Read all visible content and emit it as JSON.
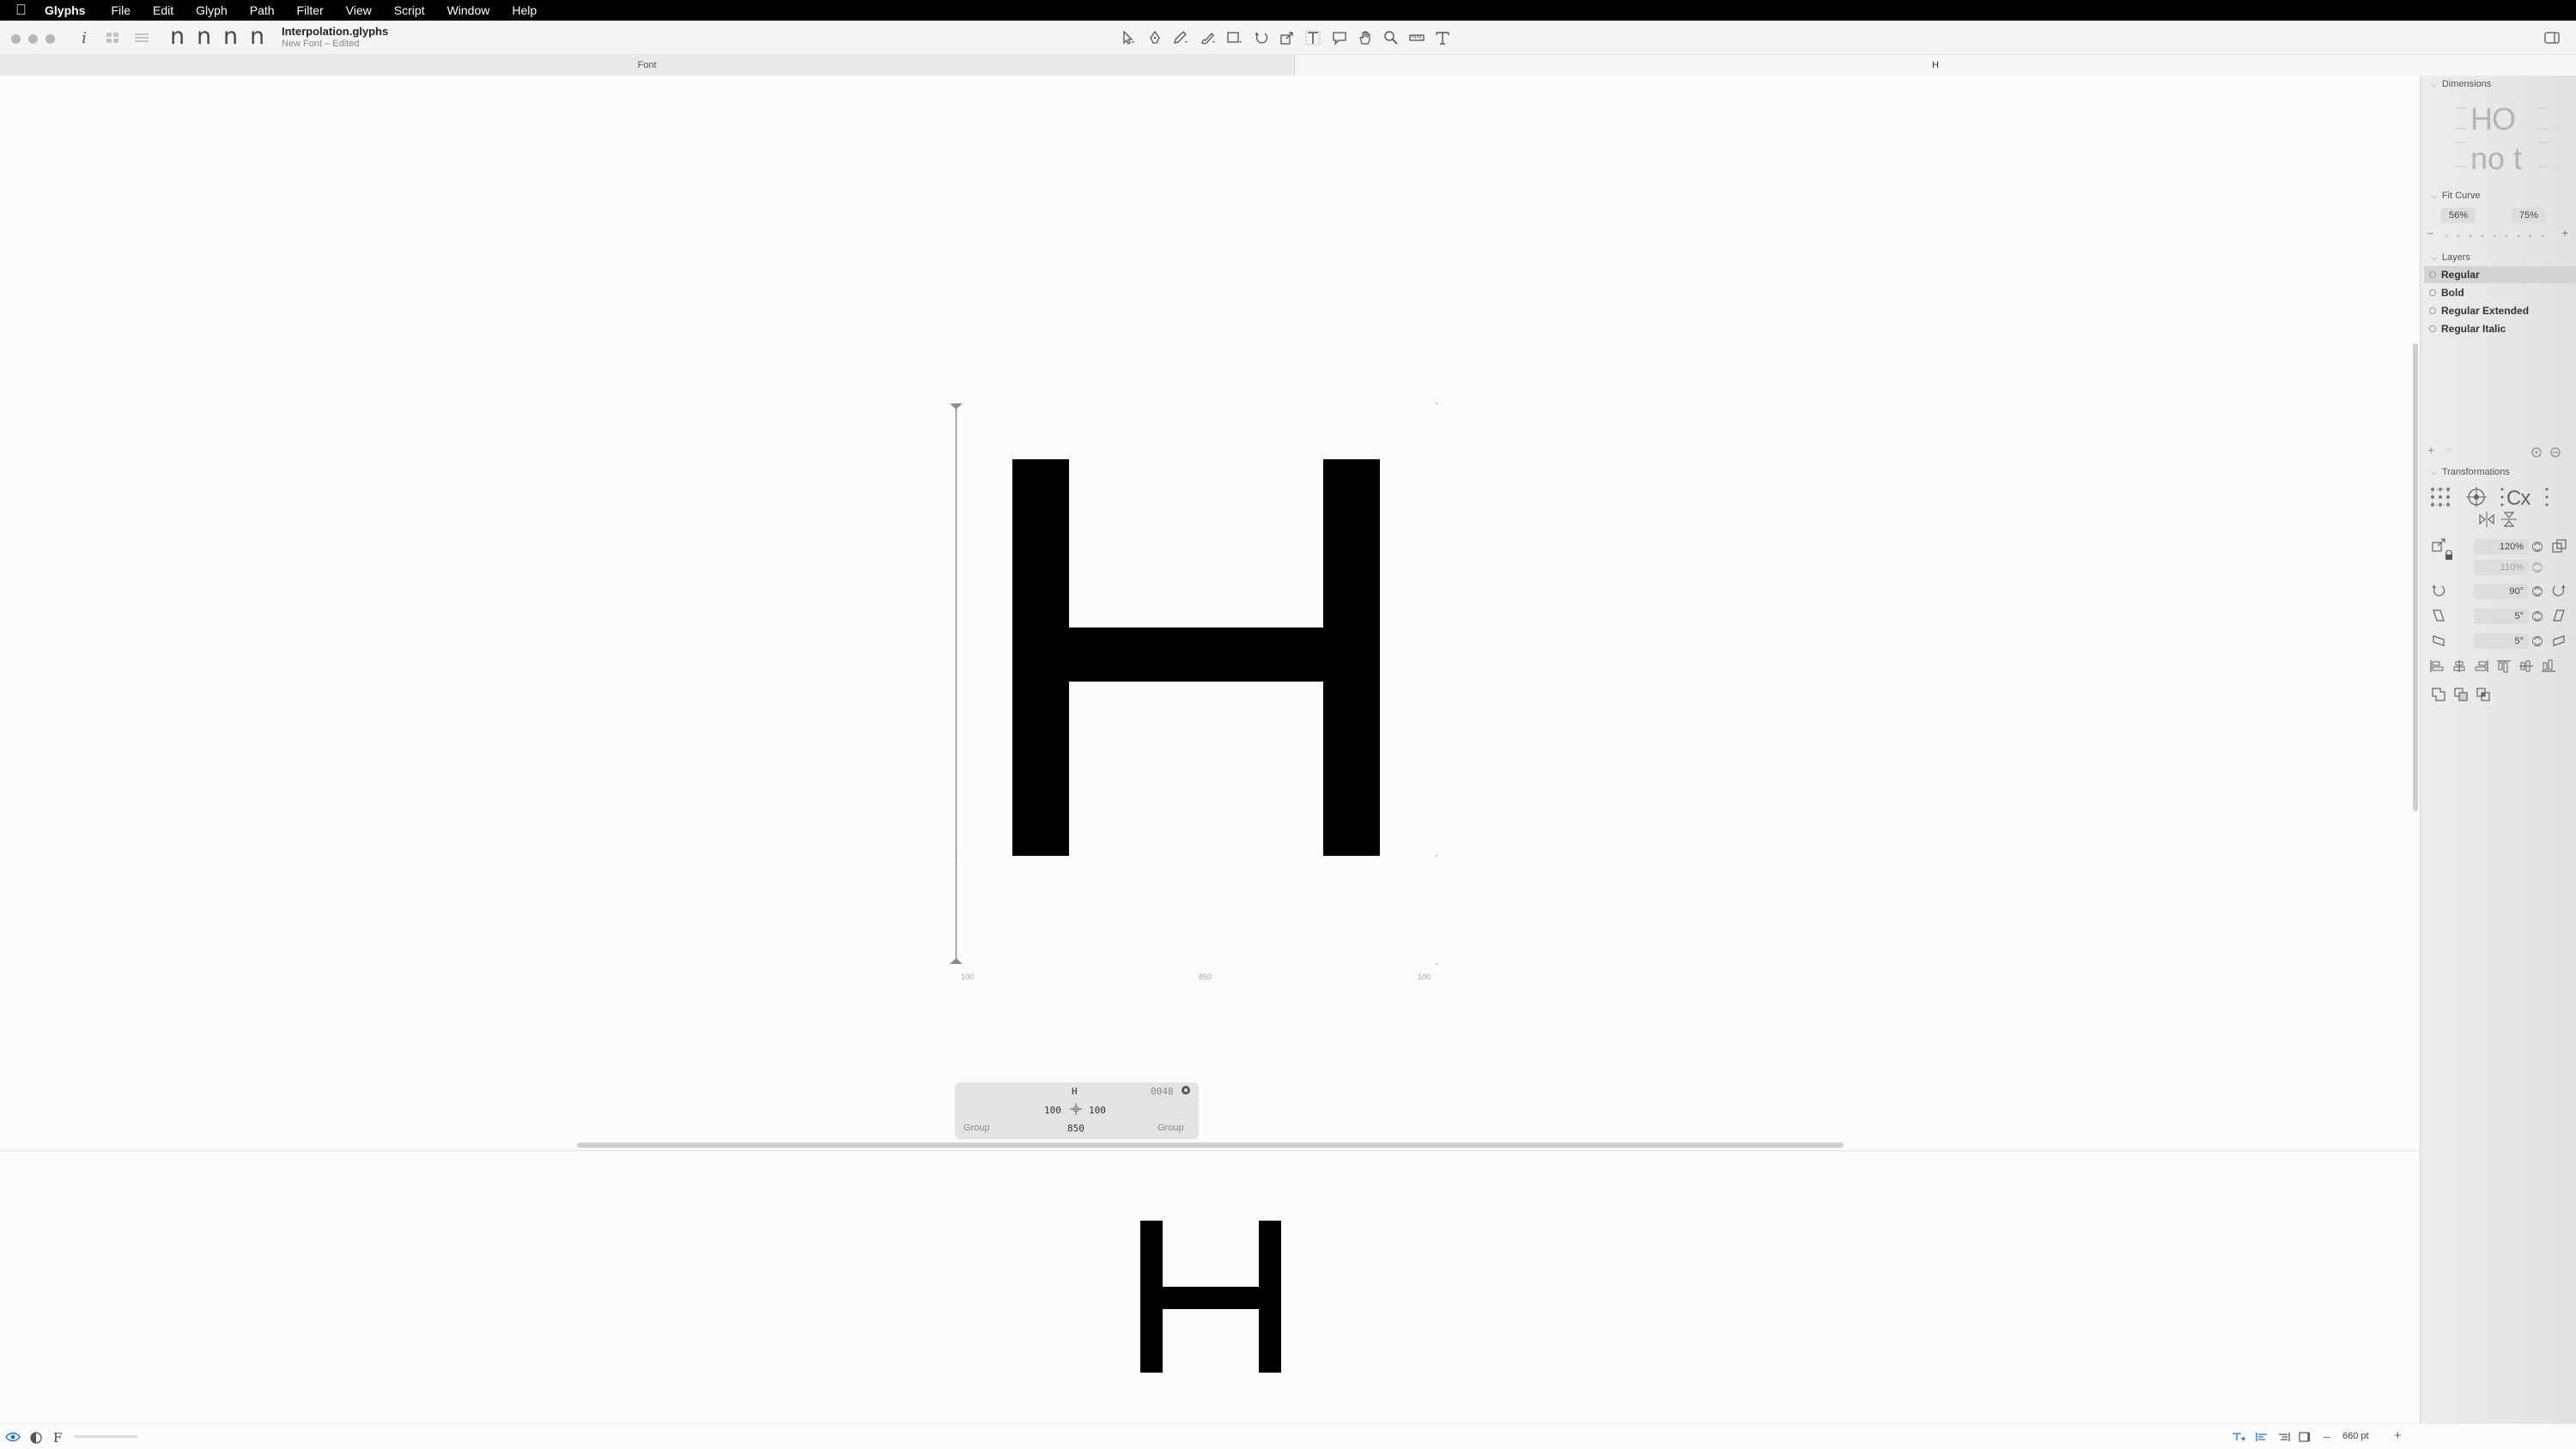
{
  "menubar": {
    "apple_icon": "apple-icon",
    "app_name": "Glyphs",
    "items": [
      "File",
      "Edit",
      "Glyph",
      "Path",
      "Filter",
      "View",
      "Script",
      "Window",
      "Help"
    ]
  },
  "toolbar": {
    "info_label": "i",
    "instance_glyphs": [
      "n",
      "n",
      "n",
      "n"
    ],
    "document_title": "Interpolation.glyphs",
    "document_subtitle": "New Font – Edited",
    "tools": [
      "select-tool-icon",
      "draw-tool-icon",
      "pencil-tool-icon",
      "brush-tool-icon",
      "rectangle-tool-icon",
      "rotate-tool-icon",
      "scale-tool-icon",
      "text-tool-icon",
      "annotation-tool-icon",
      "hand-tool-icon",
      "zoom-tool-icon",
      "measurement-tool-icon",
      "type-tool-icon"
    ]
  },
  "tabs": [
    {
      "label": "Font",
      "active": false
    },
    {
      "label": "H",
      "active": true
    }
  ],
  "glyph": {
    "name": "H",
    "unicode": "0048",
    "left_sidebearing": "100",
    "right_sidebearing": "100",
    "width": "850",
    "left_group": "Group",
    "right_group": "Group"
  },
  "metrics": {
    "lsb_label": "100",
    "width_label": "850",
    "rsb_label": "100"
  },
  "preview_text": "H",
  "bottombar": {
    "eye_icon": "eye-icon",
    "contrast_icon": "contrast-icon",
    "font_letter": "F",
    "zoom_value": "660 pt"
  },
  "palette": {
    "dimensions": {
      "title": "Dimensions",
      "sample_top": "HO",
      "sample_bottom": "no t"
    },
    "fit_curve": {
      "title": "Fit Curve",
      "min_value": "56%",
      "max_value": "75%",
      "minus": "–",
      "plus": "+"
    },
    "layers": {
      "title": "Layers",
      "items": [
        {
          "name": "Regular",
          "selected": true
        },
        {
          "name": "Bold",
          "selected": false
        },
        {
          "name": "Regular Extended",
          "selected": false
        },
        {
          "name": "Regular Italic",
          "selected": false
        }
      ]
    },
    "transformations": {
      "title": "Transformations",
      "scale_x": "120%",
      "scale_y": "110%",
      "rotate": "90°",
      "skew_x": "5°",
      "skew_y": "5°"
    }
  },
  "colors": {
    "menubar_bg": "#000000",
    "canvas_bg": "#fbfbfb",
    "glyph_fill": "#000000",
    "palette_bg": "#e8e8e8"
  }
}
